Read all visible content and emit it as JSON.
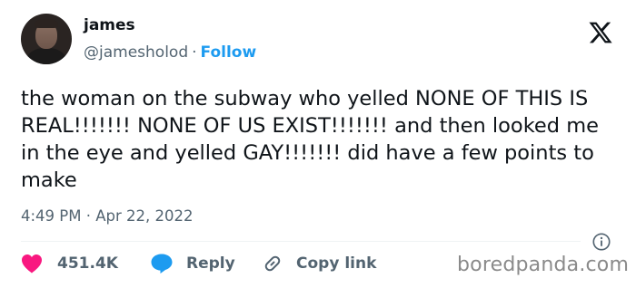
{
  "author": {
    "name": "james",
    "handle": "@jamesholod",
    "separator": "·",
    "follow_label": "Follow"
  },
  "platform_icon": "x-logo-icon",
  "tweet": {
    "text": "the woman on the subway who yelled NONE OF THIS IS REAL!!!!!!! NONE OF US EXIST!!!!!!! and then looked me in the eye and yelled GAY!!!!!!! did have a few points to make",
    "time": "4:49 PM",
    "separator": "·",
    "date": "Apr 22, 2022"
  },
  "actions": {
    "like_count": "451.4K",
    "reply_label": "Reply",
    "copy_label": "Copy link"
  },
  "watermark": "boredpanda.com",
  "colors": {
    "accent": "#1d9bf0",
    "like": "#f91880",
    "text": "#0f1419",
    "muted": "#536471"
  }
}
